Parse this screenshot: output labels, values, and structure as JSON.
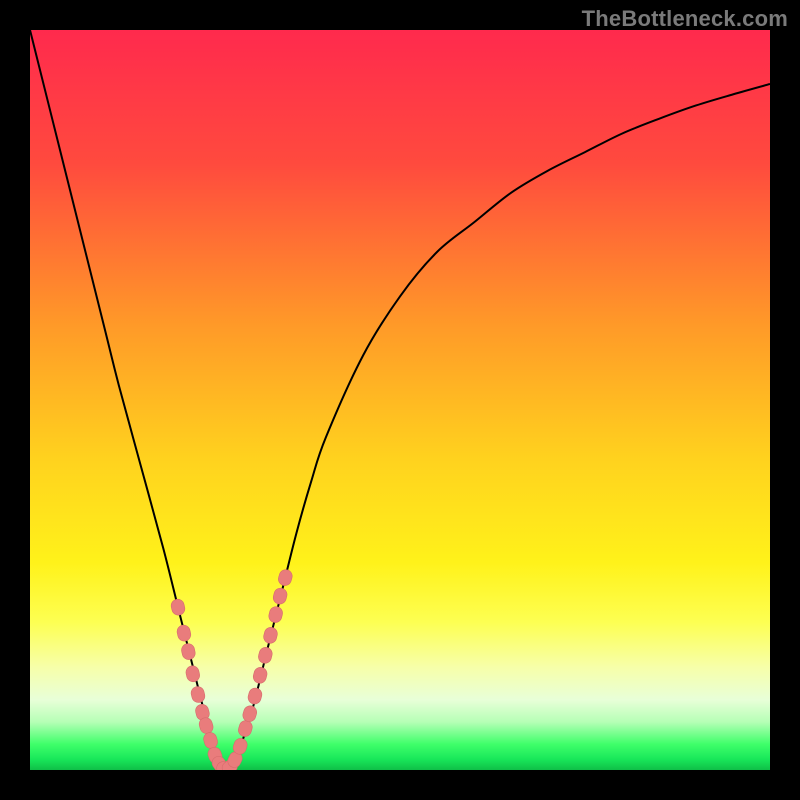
{
  "watermark": "TheBottleneck.com",
  "colors": {
    "frame": "#000000",
    "gradient_stops": [
      {
        "offset": 0.0,
        "color": "#ff2a4d"
      },
      {
        "offset": 0.18,
        "color": "#ff4a3e"
      },
      {
        "offset": 0.4,
        "color": "#ff9a28"
      },
      {
        "offset": 0.58,
        "color": "#ffd21e"
      },
      {
        "offset": 0.72,
        "color": "#fff21a"
      },
      {
        "offset": 0.8,
        "color": "#fdff52"
      },
      {
        "offset": 0.86,
        "color": "#f7ffa8"
      },
      {
        "offset": 0.905,
        "color": "#e8ffd8"
      },
      {
        "offset": 0.935,
        "color": "#b6ffb6"
      },
      {
        "offset": 0.965,
        "color": "#3fff6a"
      },
      {
        "offset": 0.985,
        "color": "#19e85a"
      },
      {
        "offset": 1.0,
        "color": "#0fbf47"
      }
    ],
    "curve_stroke": "#000000",
    "marker_fill": "#e97c7c",
    "marker_stroke": "#d76c6c"
  },
  "chart_data": {
    "type": "line",
    "title": "",
    "xlabel": "",
    "ylabel": "",
    "xlim": [
      0,
      100
    ],
    "ylim": [
      0,
      100
    ],
    "grid": false,
    "legend": false,
    "series": [
      {
        "name": "bottleneck-curve",
        "x": [
          0,
          5,
          10,
          12,
          15,
          18,
          20,
          22,
          24,
          25,
          26,
          27,
          28,
          30,
          32,
          34,
          36,
          38,
          40,
          45,
          50,
          55,
          60,
          65,
          70,
          75,
          80,
          85,
          90,
          95,
          100
        ],
        "y": [
          100,
          80,
          60,
          52,
          41,
          30,
          22,
          14,
          6,
          2,
          0,
          0,
          2,
          8,
          16,
          24,
          32,
          39,
          45,
          56,
          64,
          70,
          74,
          78,
          81,
          83.5,
          86,
          88,
          89.8,
          91.3,
          92.7
        ]
      }
    ],
    "markers": {
      "name": "highlighted-points",
      "points": [
        {
          "x": 20.0,
          "y": 22.0
        },
        {
          "x": 20.8,
          "y": 18.5
        },
        {
          "x": 21.4,
          "y": 16.0
        },
        {
          "x": 22.0,
          "y": 13.0
        },
        {
          "x": 22.7,
          "y": 10.2
        },
        {
          "x": 23.3,
          "y": 7.8
        },
        {
          "x": 23.8,
          "y": 6.0
        },
        {
          "x": 24.4,
          "y": 4.0
        },
        {
          "x": 25.0,
          "y": 2.0
        },
        {
          "x": 25.6,
          "y": 0.8
        },
        {
          "x": 26.3,
          "y": 0.2
        },
        {
          "x": 27.0,
          "y": 0.4
        },
        {
          "x": 27.7,
          "y": 1.4
        },
        {
          "x": 28.4,
          "y": 3.2
        },
        {
          "x": 29.1,
          "y": 5.6
        },
        {
          "x": 29.7,
          "y": 7.6
        },
        {
          "x": 30.4,
          "y": 10.0
        },
        {
          "x": 31.1,
          "y": 12.8
        },
        {
          "x": 31.8,
          "y": 15.5
        },
        {
          "x": 32.5,
          "y": 18.2
        },
        {
          "x": 33.2,
          "y": 21.0
        },
        {
          "x": 33.8,
          "y": 23.5
        },
        {
          "x": 34.5,
          "y": 26.0
        }
      ]
    }
  }
}
